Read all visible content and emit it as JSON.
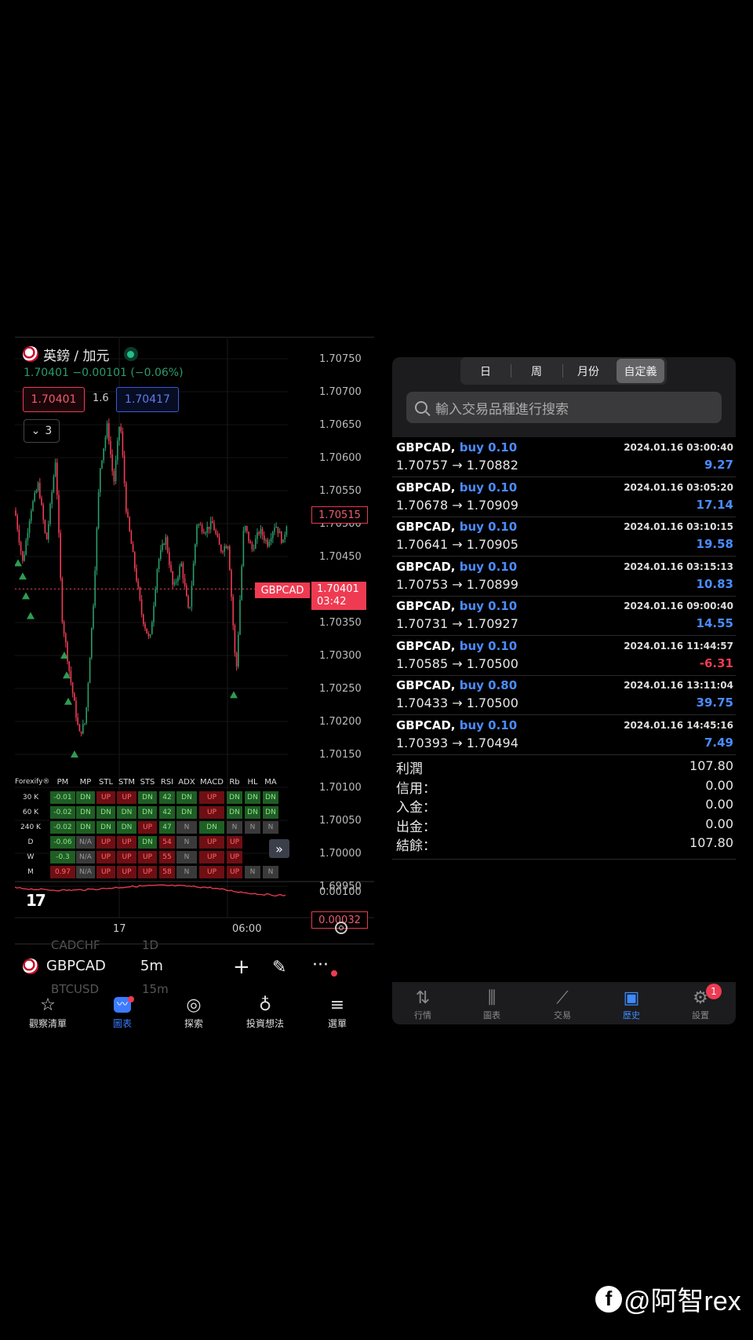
{
  "chart_panel": {
    "title": "英鎊 / 加元",
    "quote_line": "1.70401 −0.00101 (−0.06%)",
    "sell_price": "1.70401",
    "spread": "1.6",
    "buy_price": "1.70417",
    "indicators_count": "3",
    "price_axis": [
      "1.70750",
      "1.70700",
      "1.70650",
      "1.70600",
      "1.70550",
      "1.70500",
      "1.70450",
      "1.70400",
      "1.70350",
      "1.70300",
      "1.70250",
      "1.70200",
      "1.70150",
      "1.70100",
      "1.70050",
      "1.70000",
      "1.69950"
    ],
    "high_tag": "1.70515",
    "symbol_tag": "GBPCAD",
    "current_price": "1.70401",
    "countdown": "03:42",
    "osc_axis_label": "0.00100",
    "osc_tag": "0.00032",
    "x_labels": [
      "17",
      "06:00"
    ],
    "indicator_table": {
      "brand": "Forexify®",
      "headers": [
        "PM",
        "MP",
        "STL",
        "STM",
        "STS",
        "RSI",
        "ADX",
        "MACD",
        "Rb",
        "HL",
        "MA"
      ],
      "rows": [
        {
          "label": "30 K",
          "cells": [
            [
              "-0.01",
              "g"
            ],
            [
              "DN",
              "g"
            ],
            [
              "UP",
              "r"
            ],
            [
              "UP",
              "r"
            ],
            [
              "DN",
              "g"
            ],
            [
              "42",
              "g"
            ],
            [
              "DN",
              "g"
            ],
            [
              "UP",
              "r"
            ],
            [
              "DN",
              "g"
            ],
            [
              "DN",
              "g"
            ],
            [
              "DN",
              "g"
            ]
          ]
        },
        {
          "label": "60 K",
          "cells": [
            [
              "-0.02",
              "g"
            ],
            [
              "DN",
              "g"
            ],
            [
              "DN",
              "g"
            ],
            [
              "DN",
              "g"
            ],
            [
              "DN",
              "g"
            ],
            [
              "42",
              "g"
            ],
            [
              "DN",
              "g"
            ],
            [
              "UP",
              "r"
            ],
            [
              "DN",
              "g"
            ],
            [
              "DN",
              "g"
            ],
            [
              "DN",
              "g"
            ]
          ]
        },
        {
          "label": "240 K",
          "cells": [
            [
              "-0.02",
              "g"
            ],
            [
              "DN",
              "g"
            ],
            [
              "DN",
              "g"
            ],
            [
              "DN",
              "g"
            ],
            [
              "UP",
              "r"
            ],
            [
              "47",
              "g"
            ],
            [
              "N",
              "n"
            ],
            [
              "DN",
              "g"
            ],
            [
              "N",
              "n"
            ],
            [
              "N",
              "n"
            ],
            [
              "N",
              "n"
            ]
          ]
        },
        {
          "label": "D",
          "cells": [
            [
              "-0.06",
              "g"
            ],
            [
              "N/A",
              "n"
            ],
            [
              "UP",
              "r"
            ],
            [
              "UP",
              "r"
            ],
            [
              "DN",
              "g"
            ],
            [
              "54",
              "r"
            ],
            [
              "N",
              "n"
            ],
            [
              "UP",
              "r"
            ],
            [
              "UP",
              "r"
            ],
            [
              "",
              ""
            ],
            [
              "",
              ""
            ]
          ]
        },
        {
          "label": "W",
          "cells": [
            [
              "-0.3",
              "g"
            ],
            [
              "N/A",
              "n"
            ],
            [
              "UP",
              "r"
            ],
            [
              "UP",
              "r"
            ],
            [
              "UP",
              "r"
            ],
            [
              "55",
              "r"
            ],
            [
              "N",
              "n"
            ],
            [
              "UP",
              "r"
            ],
            [
              "UP",
              "r"
            ],
            [
              "",
              ""
            ],
            [
              "",
              ""
            ]
          ]
        },
        {
          "label": "M",
          "cells": [
            [
              "0.97",
              "r"
            ],
            [
              "N/A",
              "n"
            ],
            [
              "UP",
              "r"
            ],
            [
              "UP",
              "r"
            ],
            [
              "UP",
              "r"
            ],
            [
              "58",
              "r"
            ],
            [
              "N",
              "n"
            ],
            [
              "UP",
              "r"
            ],
            [
              "UP",
              "r"
            ],
            [
              "N",
              "n"
            ],
            [
              "N",
              "n"
            ]
          ]
        }
      ]
    },
    "ghost_rows": [
      [
        "CADCHF",
        "1D"
      ],
      [
        "BTCUSD",
        "15m"
      ]
    ],
    "symbol": "GBPCAD",
    "timeframe": "5m",
    "tabs": [
      {
        "label": "觀察清單",
        "icon": "star-icon"
      },
      {
        "label": "圖表",
        "icon": "chart-icon"
      },
      {
        "label": "探索",
        "icon": "compass-icon"
      },
      {
        "label": "投資想法",
        "icon": "lightbulb-icon"
      },
      {
        "label": "選單",
        "icon": "menu-icon"
      }
    ]
  },
  "history_panel": {
    "segments": [
      "日",
      "周",
      "月份",
      "自定義"
    ],
    "active_segment": "自定義",
    "search_placeholder": "輸入交易品種進行搜索",
    "trades": [
      {
        "symbol": "GBPCAD,",
        "side": "buy 0.10",
        "time": "2024.01.16 03:00:40",
        "prices": "1.70757 → 1.70882",
        "profit": "9.27",
        "neg": false
      },
      {
        "symbol": "GBPCAD,",
        "side": "buy 0.10",
        "time": "2024.01.16 03:05:20",
        "prices": "1.70678 → 1.70909",
        "profit": "17.14",
        "neg": false
      },
      {
        "symbol": "GBPCAD,",
        "side": "buy 0.10",
        "time": "2024.01.16 03:10:15",
        "prices": "1.70641 → 1.70905",
        "profit": "19.58",
        "neg": false
      },
      {
        "symbol": "GBPCAD,",
        "side": "buy 0.10",
        "time": "2024.01.16 03:15:13",
        "prices": "1.70753 → 1.70899",
        "profit": "10.83",
        "neg": false
      },
      {
        "symbol": "GBPCAD,",
        "side": "buy 0.10",
        "time": "2024.01.16 09:00:40",
        "prices": "1.70731 → 1.70927",
        "profit": "14.55",
        "neg": false
      },
      {
        "symbol": "GBPCAD,",
        "side": "buy 0.10",
        "time": "2024.01.16 11:44:57",
        "prices": "1.70585 → 1.70500",
        "profit": "-6.31",
        "neg": true
      },
      {
        "symbol": "GBPCAD,",
        "side": "buy 0.80",
        "time": "2024.01.16 13:11:04",
        "prices": "1.70433 → 1.70500",
        "profit": "39.75",
        "neg": false
      },
      {
        "symbol": "GBPCAD,",
        "side": "buy 0.10",
        "time": "2024.01.16 14:45:16",
        "prices": "1.70393 → 1.70494",
        "profit": "7.49",
        "neg": false
      }
    ],
    "summary": [
      {
        "label": "利潤",
        "value": "107.80"
      },
      {
        "label": "信用：",
        "value": "0.00"
      },
      {
        "label": "入金：",
        "value": "0.00"
      },
      {
        "label": "出金：",
        "value": "0.00"
      },
      {
        "label": "結餘：",
        "value": "107.80"
      }
    ],
    "tabs": [
      {
        "label": "行情",
        "icon": "quotes-icon"
      },
      {
        "label": "圖表",
        "icon": "candles-icon"
      },
      {
        "label": "交易",
        "icon": "trade-icon"
      },
      {
        "label": "歷史",
        "icon": "history-icon"
      },
      {
        "label": "設置",
        "icon": "settings-icon"
      }
    ],
    "active_tab": "歷史",
    "settings_badge": "1"
  },
  "watermark": "@阿智rex",
  "colors": {
    "up": "#ef3b52",
    "down": "#2a9c6a",
    "accent": "#3c7bff"
  }
}
